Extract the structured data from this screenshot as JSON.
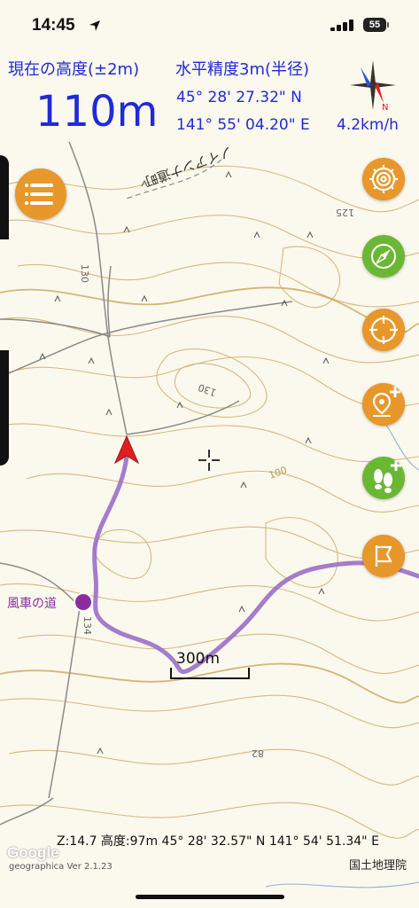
{
  "status_bar": {
    "time": "14:45",
    "battery": "55"
  },
  "hud": {
    "altitude_label": "現在の高度(±2m)",
    "accuracy_label": "水平精度3m(半径)",
    "altitude_value": "110m",
    "latitude": "45° 28' 27.32\" N",
    "longitude": "141° 55' 04.20\" E",
    "speed": "4.2km/h"
  },
  "compass": {
    "letter_n": "N"
  },
  "map": {
    "place_label": "風車の道",
    "scale_label": "300m",
    "colors": {
      "contour": "#c9a55a",
      "track": "#9a6fc7",
      "road": "#8a8a8a",
      "accent": "#e8972a",
      "green": "#6ab734"
    }
  },
  "bottom": {
    "info": "Z:14.7 高度:97m  45° 28' 32.57\" N 141° 54' 51.34\" E",
    "google": "Google",
    "version": "geographica Ver 2.1.23",
    "attribution": "国土地理院"
  },
  "buttons": {
    "menu": "menu-icon",
    "fab1": "shell-icon",
    "fab2": "compass-icon",
    "fab3": "target-icon",
    "fab4": "add-pin-icon",
    "fab5": "footprints-add-icon",
    "fab6": "flag-icon"
  }
}
